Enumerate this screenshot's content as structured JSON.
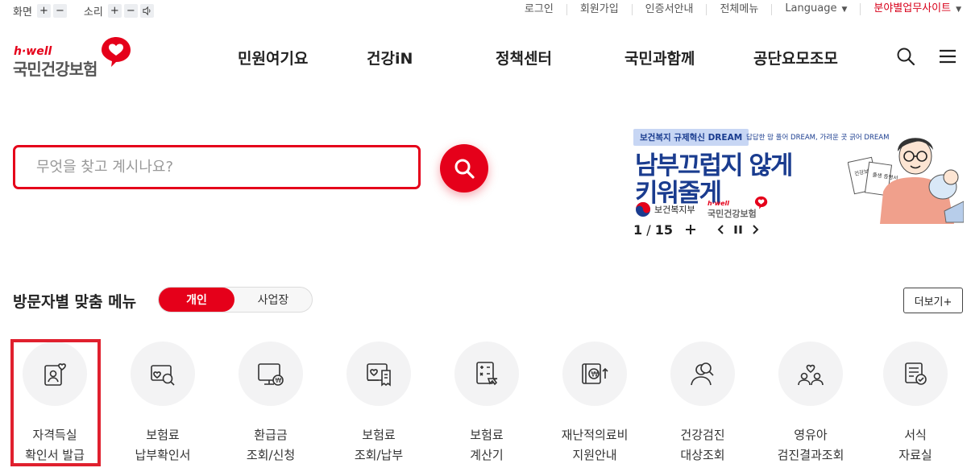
{
  "util": {
    "screen_label": "화면",
    "sound_label": "소리",
    "plus": "+",
    "minus": "−",
    "links": [
      "로그인",
      "회원가입",
      "인증서안내",
      "전체메뉴"
    ],
    "language": "Language",
    "related_site": "분야별업무사이트"
  },
  "logo": {
    "hwell": "h·well",
    "name": "국민건강보험"
  },
  "gnb": [
    "민원여기요",
    "건강iN",
    "정책센터",
    "국민과함께",
    "공단요모조모"
  ],
  "search": {
    "placeholder": "무엇을 찾고 계시나요?"
  },
  "banner": {
    "tag": "보건복지 규제혁신 DREAM",
    "sub": "답답한 맘 풀어 DREAM, 가려운 곳 긁어 DREAM",
    "title_line1": "남부끄럽지 않게",
    "title_line2": "키워줄게",
    "org1": "보건복지부",
    "org2_hwell": "h·well",
    "org2": "국민건강보험",
    "counter_current": "1",
    "counter_total": "15",
    "counter_sep": " / ",
    "doc1": "건강보험 취득서",
    "doc2": "출생 증명서"
  },
  "section": {
    "title": "방문자별 맞춤 메뉴",
    "tab_personal": "개인",
    "tab_business": "사업장",
    "more": "더보기+"
  },
  "quick_menu": [
    {
      "line1": "자격득실",
      "line2": "확인서 발급",
      "icon": "id-card-heart-icon"
    },
    {
      "line1": "보험료",
      "line2": "납부확인서",
      "icon": "document-search-icon"
    },
    {
      "line1": "환급금",
      "line2": "조회/신청",
      "icon": "monitor-won-icon"
    },
    {
      "line1": "보험료",
      "line2": "조회/납부",
      "icon": "receipt-icon"
    },
    {
      "line1": "보험료",
      "line2": "계산기",
      "icon": "calculator-icon"
    },
    {
      "line1": "재난적의료비",
      "line2": "지원안내",
      "icon": "wallet-won-icon"
    },
    {
      "line1": "건강검진",
      "line2": "대상조회",
      "icon": "person-search-icon"
    },
    {
      "line1": "영유아",
      "line2": "검진결과조회",
      "icon": "family-heart-icon"
    },
    {
      "line1": "서식",
      "line2": "자료실",
      "icon": "form-check-icon"
    }
  ],
  "colors": {
    "brand_red": "#e5001a",
    "banner_blue": "#1a3c8f"
  }
}
